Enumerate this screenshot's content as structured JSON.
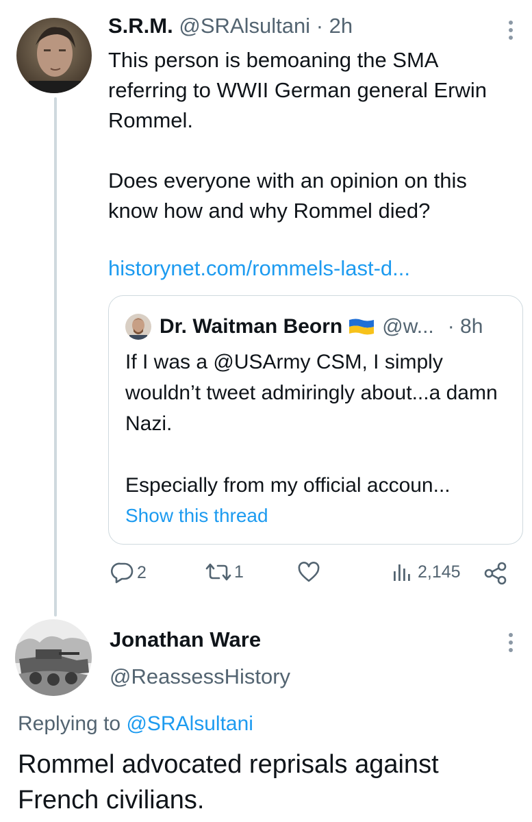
{
  "tweet": {
    "author_name": "S.R.M.",
    "author_handle": "@SRAlsultani",
    "time": "· 2h",
    "text": "This person is bemoaning the SMA referring to WWII German general Erwin Rommel.\n\nDoes everyone with an opinion on this know how and why Rommel died?",
    "link": "historynet.com/rommels-last-d...",
    "quote": {
      "author_name": "Dr. Waitman Beorn",
      "flag_icon": "ukraine-flag-icon",
      "author_handle": "@w...",
      "time": "· 8h",
      "text": "If I was a @USArmy CSM, I simply wouldn’t tweet admiringly about...a damn Nazi.\n\nEspecially from my official accoun...",
      "show_thread": "Show this thread"
    },
    "actions": {
      "replies": "2",
      "retweets": "1",
      "views": "2,145"
    }
  },
  "reply": {
    "author_name": "Jonathan Ware",
    "author_handle": "@ReassessHistory",
    "replying_label": "Replying to",
    "replying_to": "@SRAlsultani",
    "text": "Rommel advocated reprisals against French civilians."
  },
  "colors": {
    "accent": "#1d9bf0",
    "muted": "#536471",
    "border": "#cfd9de"
  }
}
